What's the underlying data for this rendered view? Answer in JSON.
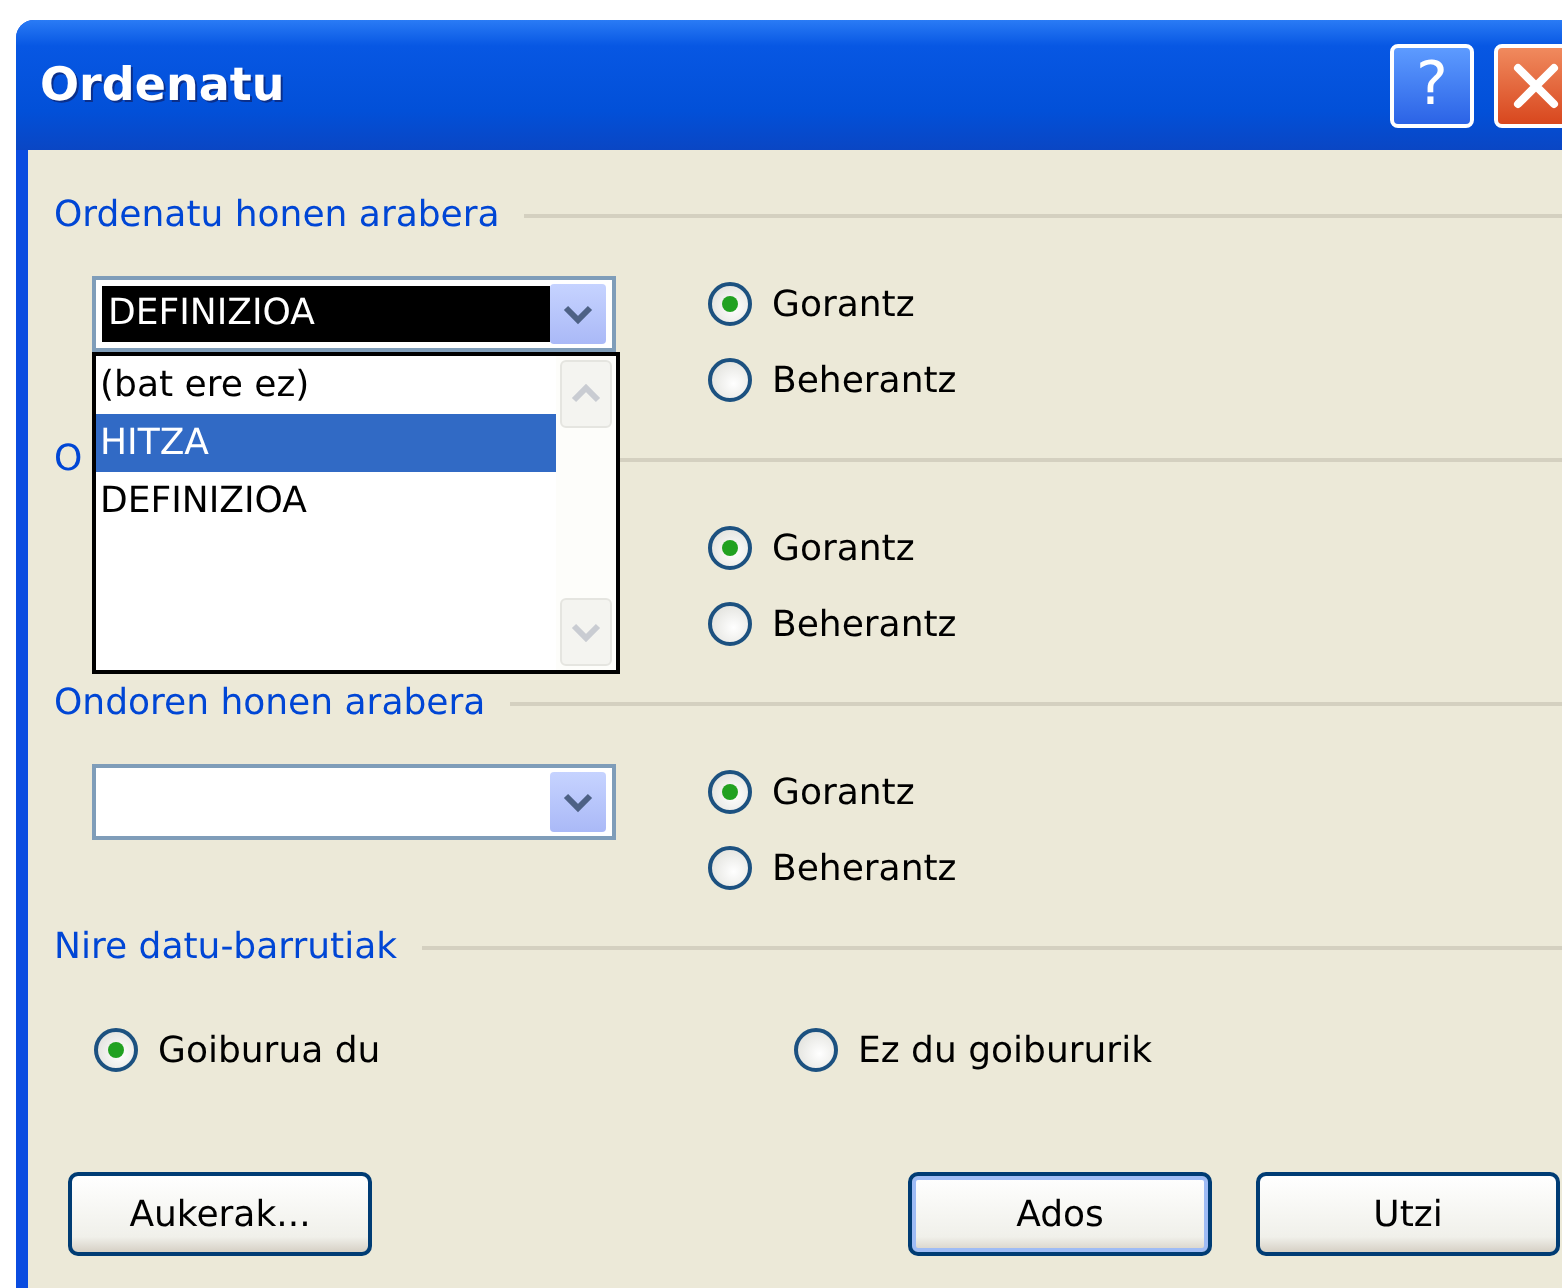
{
  "window": {
    "title": "Ordenatu",
    "help_label": "?"
  },
  "sort_keys": [
    {
      "label": "Ordenatu honen arabera",
      "combo": {
        "value": "DEFINIZIOA",
        "highlighted": true
      },
      "options": [
        {
          "label": "Gorantz",
          "selected": true
        },
        {
          "label": "Beherantz",
          "selected": false
        }
      ]
    },
    {
      "label": "O",
      "options": [
        {
          "label": "Gorantz",
          "selected": true
        },
        {
          "label": "Beherantz",
          "selected": false
        }
      ]
    },
    {
      "label": "Ondoren honen arabera",
      "combo": {
        "highlighted": false
      },
      "options": [
        {
          "label": "Gorantz",
          "selected": true
        },
        {
          "label": "Beherantz",
          "selected": false
        }
      ]
    }
  ],
  "dropdown": {
    "items": [
      {
        "label": "(bat ere ez)",
        "selected": false
      },
      {
        "label": "HITZA",
        "selected": true
      },
      {
        "label": "DEFINIZIOA",
        "selected": false
      }
    ]
  },
  "data_range": {
    "label": "Nire datu-barrutiak",
    "options": [
      {
        "label": "Goiburua du",
        "selected": true
      },
      {
        "label": "Ez du goibururik",
        "selected": false
      }
    ]
  },
  "buttons": [
    {
      "label": "Aukerak...",
      "kind": "options",
      "default": false
    },
    {
      "label": "Ados",
      "kind": "action",
      "default": true
    },
    {
      "label": "Utzi",
      "kind": "action",
      "default": false
    }
  ]
}
